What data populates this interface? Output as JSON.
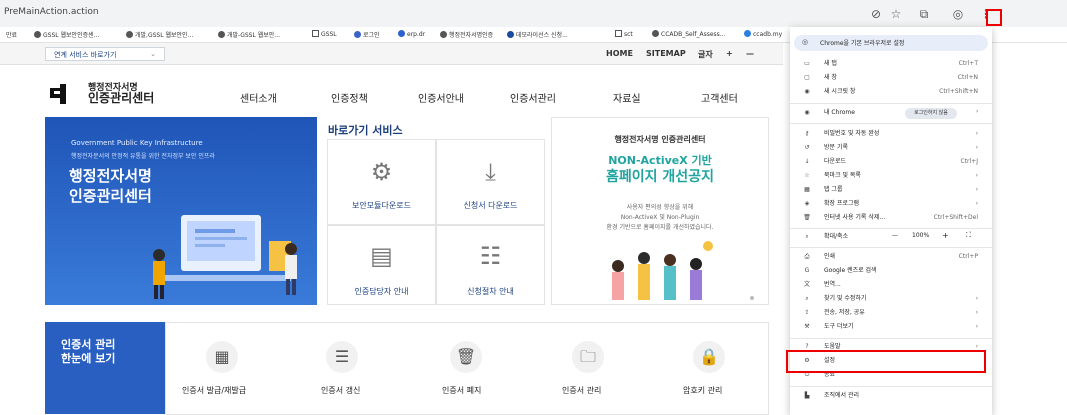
{
  "browser": {
    "url": "PreMainAction.action",
    "bookmarks": [
      "만료",
      "GSSL 웹보안인증센...",
      "개발,GSSL 웹보안인...",
      "개발-GSSL 웹보안...",
      "GSSL",
      "로그인",
      "erp.dr",
      "행정전자서명인증",
      "데모라이선스 신청...",
      "sct",
      "CCADB_Self_Assess...",
      "ccadb.my"
    ]
  },
  "site": {
    "service_select": "연계 서비스 바로가기",
    "global_links": [
      "HOME",
      "SITEMAP",
      "글자",
      "+",
      "—"
    ],
    "logo_line1": "행정전자서명",
    "logo_line2": "인증관리센터",
    "nav": [
      "센터소개",
      "인증정책",
      "인증서안내",
      "인증서관리",
      "자료실",
      "고객센터"
    ],
    "hero": {
      "en": "Government Public Key Infrastructure",
      "sub": "행정전자문서의 안정적 유통을 위한 전자정부 보안 인프라",
      "t1": "행정전자서명",
      "t2": "인증관리센터"
    },
    "quick_title": "바로가기 서비스",
    "quick": [
      "보안모듈다운로드",
      "신청서 다운로드",
      "인증담당자 안내",
      "신청절차 안내"
    ],
    "notice": {
      "org": "행정전자서명 인증관리센터",
      "l1": "NON-ActiveX 기반",
      "l2": "홈페이지 개선공지",
      "d1": "사용자 편의성 향상을 위해",
      "d2": "Non-ActiveX 및 Non-Plugin",
      "d3": "환경 기반으로 홈페이지를 개선하였습니다."
    },
    "bottom_title1": "인증서 관리",
    "bottom_title2": "한눈에 보기",
    "bottom_items": [
      "인증서 발급/재발급",
      "인증서 갱신",
      "인증서 폐지",
      "인증서 관리",
      "암호키 관리"
    ]
  },
  "menu": {
    "default_browser": "Chrome을 기본 브라우저로 설정",
    "items": [
      {
        "icon": "▭",
        "label": "새 탭",
        "shortcut": "Ctrl+T"
      },
      {
        "icon": "▢",
        "label": "새 창",
        "shortcut": "Ctrl+N"
      },
      {
        "icon": "◉",
        "label": "새 시크릿 창",
        "shortcut": "Ctrl+Shift+N"
      }
    ],
    "my_chrome": "내 Chrome",
    "my_chrome_btn": "로그인하지 않음",
    "items2": [
      {
        "icon": "⚷",
        "label": "비밀번호 및 자동 완성",
        "shortcut": "›"
      },
      {
        "icon": "↺",
        "label": "방문 기록",
        "shortcut": "›"
      },
      {
        "icon": "↓",
        "label": "다운로드",
        "shortcut": "Ctrl+J"
      },
      {
        "icon": "☆",
        "label": "북마크 및 목록",
        "shortcut": "›"
      },
      {
        "icon": "▦",
        "label": "탭 그룹",
        "shortcut": "›"
      },
      {
        "icon": "◈",
        "label": "확장 프로그램",
        "shortcut": "›"
      },
      {
        "icon": "🗑",
        "label": "인터넷 사용 기록 삭제...",
        "shortcut": "Ctrl+Shift+Del"
      }
    ],
    "zoom_label": "확대/축소",
    "zoom_minus": "—",
    "zoom_value": "100%",
    "zoom_plus": "+",
    "zoom_full": "⛶",
    "items3": [
      {
        "icon": "⎙",
        "label": "인쇄",
        "shortcut": "Ctrl+P"
      },
      {
        "icon": "G",
        "label": "Google 렌즈로 검색",
        "shortcut": ""
      },
      {
        "icon": "文",
        "label": "번역...",
        "shortcut": ""
      },
      {
        "icon": "⌕",
        "label": "찾기 및 수정하기",
        "shortcut": "›"
      },
      {
        "icon": "⇪",
        "label": "전송, 저장, 공유",
        "shortcut": "›"
      },
      {
        "icon": "⚒",
        "label": "도구 더보기",
        "shortcut": "›"
      }
    ],
    "items4": [
      {
        "icon": "?",
        "label": "도움말",
        "shortcut": "›"
      },
      {
        "icon": "⚙",
        "label": "설정",
        "shortcut": ""
      },
      {
        "icon": "⏻",
        "label": "종료",
        "shortcut": ""
      }
    ],
    "managed": "조직에서 관리"
  }
}
